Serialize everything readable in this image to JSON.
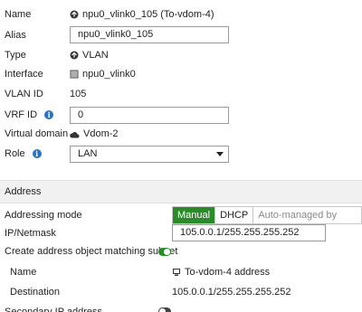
{
  "fields": {
    "name": {
      "label": "Name",
      "value": "npu0_vlink0_105 (To-vdom-4)"
    },
    "alias": {
      "label": "Alias",
      "value": "npu0_vlink0_105"
    },
    "type": {
      "label": "Type",
      "value": "VLAN"
    },
    "interface": {
      "label": "Interface",
      "value": "npu0_vlink0"
    },
    "vlan_id": {
      "label": "VLAN ID",
      "value": "105"
    },
    "vrf_id": {
      "label": "VRF ID",
      "value": "0"
    },
    "virtual_domain": {
      "label": "Virtual domain",
      "value": "Vdom-2"
    },
    "role": {
      "label": "Role",
      "value": "LAN"
    }
  },
  "address": {
    "section_title": "Address",
    "addressing_mode_label": "Addressing mode",
    "modes": [
      "Manual",
      "DHCP",
      "Auto-managed by FortiIPAM"
    ],
    "selected_mode": "Manual",
    "ip_label": "IP/Netmask",
    "ip_value": "105.0.0.1/255.255.255.252",
    "create_object_label": "Create address object matching subnet",
    "create_object_enabled": true,
    "sub_name_label": "Name",
    "sub_name_value": "To-vdom-4 address",
    "sub_dest_label": "Destination",
    "sub_dest_value": "105.0.0.1/255.255.255.252",
    "secondary_label": "Secondary IP address",
    "secondary_enabled": false
  },
  "colors": {
    "accent_green": "#2b8a29",
    "info_blue": "#2874c4"
  }
}
